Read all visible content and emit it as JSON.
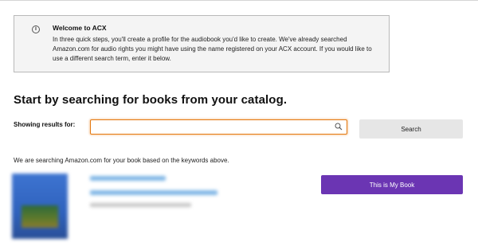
{
  "notice": {
    "icon": "info-icon",
    "title": "Welcome to ACX",
    "body": "In three quick steps, you'll create a profile for the audiobook you'd like to create. We've already searched Amazon.com for audio rights you might have using the name registered on your ACX account. If you would like to use a different search term, enter it below."
  },
  "search": {
    "heading": "Start by searching for books from your catalog.",
    "results_label": "Showing results for:",
    "input_value": "",
    "input_icon": "search-icon",
    "button_label": "Search",
    "status_text": "We are searching Amazon.com for your book based on the keywords above."
  },
  "result": {
    "select_label": "This is My Book"
  },
  "colors": {
    "accent_purple": "#6b35b3",
    "focus_orange": "#e47911",
    "secondary_button": "#e6e6e6"
  }
}
